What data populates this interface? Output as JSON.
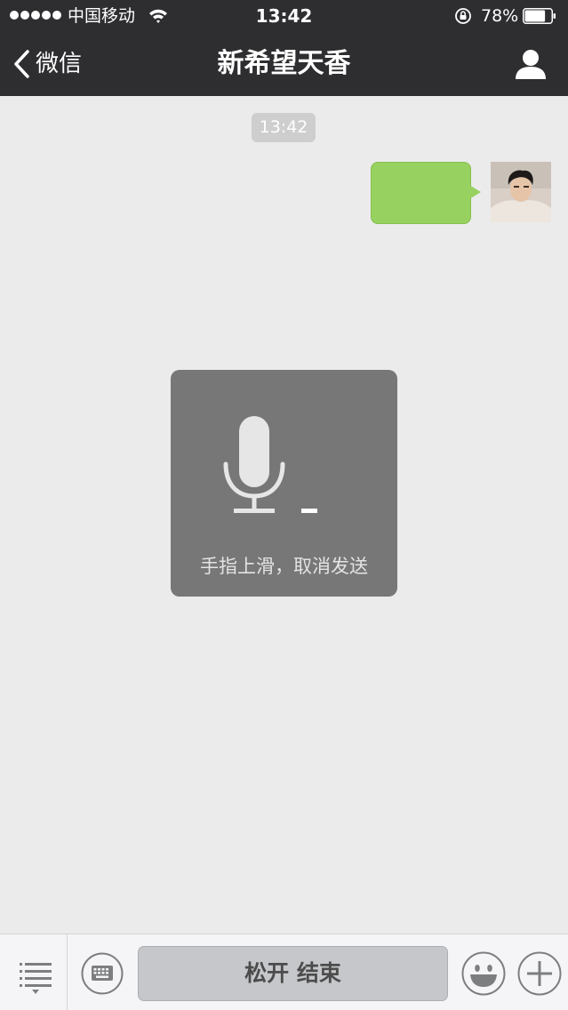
{
  "status_bar": {
    "carrier": "中国移动",
    "time": "13:42",
    "battery_percent": "78%",
    "battery_level": 0.78,
    "signal_bars": 5
  },
  "nav": {
    "back_label": "微信",
    "title": "新希望天香",
    "icons": {
      "back": "chevron-left-icon",
      "profile": "person-icon"
    }
  },
  "chat": {
    "timestamp": "13:42",
    "messages": [
      {
        "sender": "self",
        "type": "voice",
        "bubble_color": "#97d160"
      }
    ]
  },
  "recording": {
    "hint": "手指上滑，取消发送",
    "icon": "microphone-icon"
  },
  "toolbar": {
    "hold_button_label": "松开 结束",
    "icons": {
      "menu": "list-menu-icon",
      "keyboard": "keyboard-icon",
      "emoji": "smiley-icon",
      "more": "plus-icon"
    }
  },
  "colors": {
    "header_bg": "#2e2e31",
    "chat_bg": "#ebebeb",
    "bubble_green": "#97d160",
    "toolbar_bg": "#f5f5f7"
  }
}
